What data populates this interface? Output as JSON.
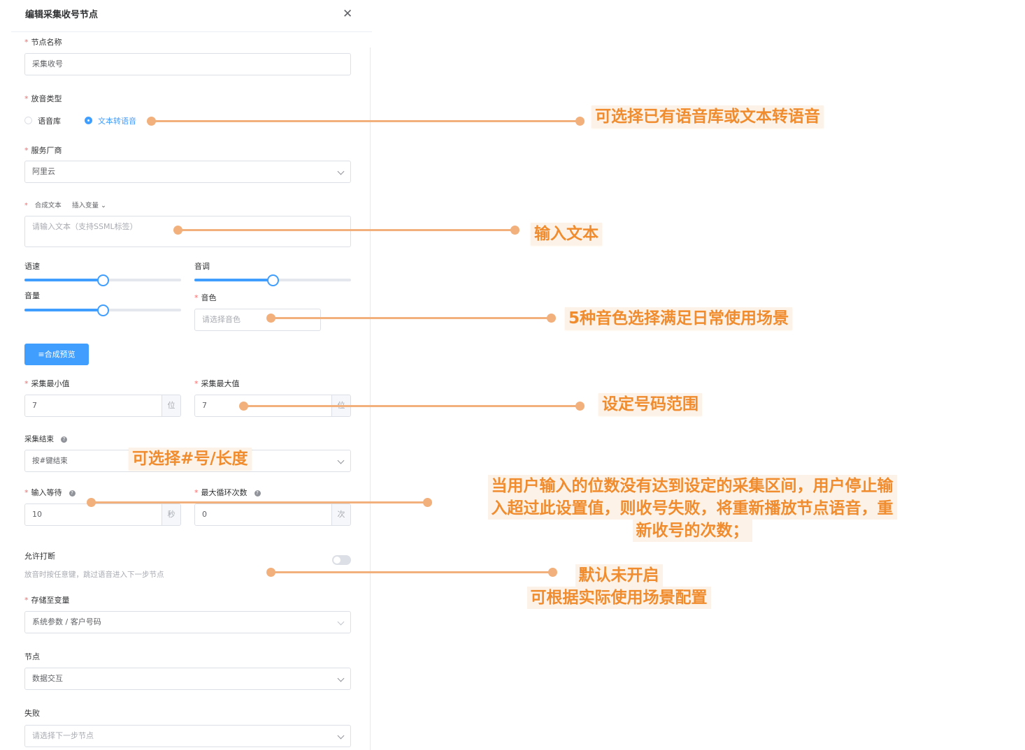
{
  "dialog": {
    "title": "编辑采集收号节点"
  },
  "fields": {
    "node_name": {
      "label": "节点名称",
      "value": "采集收号"
    },
    "playback_type": {
      "label": "放音类型",
      "options": [
        "语音库",
        "文本转语音"
      ],
      "selected": "文本转语音"
    },
    "vendor": {
      "label": "服务厂商",
      "value": "阿里云"
    },
    "synth_text": {
      "label": "合成文本",
      "insert_var": "插入变量",
      "placeholder": "请输入文本（支持SSML标签）"
    },
    "speed": {
      "label": "语速",
      "level": 0.5
    },
    "pitch": {
      "label": "音调",
      "level": 0.5
    },
    "volume": {
      "label": "音量",
      "level": 0.5
    },
    "timbre": {
      "label": "音色",
      "placeholder": "请选择音色"
    },
    "preview_button": "≡合成预览",
    "collect_min": {
      "label": "采集最小值",
      "value": "7",
      "unit": "位"
    },
    "collect_max": {
      "label": "采集最大值",
      "value": "7",
      "unit": "位"
    },
    "collect_end": {
      "label": "采集结束",
      "value": "按#键结束"
    },
    "input_wait": {
      "label": "输入等待",
      "value": "10",
      "unit": "秒"
    },
    "max_loops": {
      "label": "最大循环次数",
      "value": "0",
      "unit": "次"
    },
    "allow_interrupt": {
      "label": "允许打断",
      "hint": "放音时按任意键，跳过语音进入下一步节点",
      "enabled": false
    },
    "store_var": {
      "label": "存储至变量",
      "value": "系统参数 / 客户号码"
    },
    "node": {
      "label": "节点",
      "value": "数据交互"
    },
    "fail": {
      "label": "失败",
      "placeholder": "请选择下一步节点"
    }
  },
  "annotations": {
    "playback": "可选择已有语音库或文本转语音",
    "text": "输入文本",
    "timbre": "5种音色选择满足日常使用场景",
    "range": "设定号码范围",
    "end": "可选择#号/长度",
    "wait": [
      "当用户输入的位数没有达到设定的采集区间，用户停止输",
      "入超过此设置值，则收号失败，将重新播放节点语音，重",
      "新收号的次数；"
    ],
    "interrupt": [
      "默认未开启",
      "可根据实际使用场景配置"
    ]
  },
  "colors": {
    "primary": "#409eff",
    "required_star": "#f56c6c",
    "annotation": "#f08c2e",
    "annotation_line": "#f2b07c"
  }
}
